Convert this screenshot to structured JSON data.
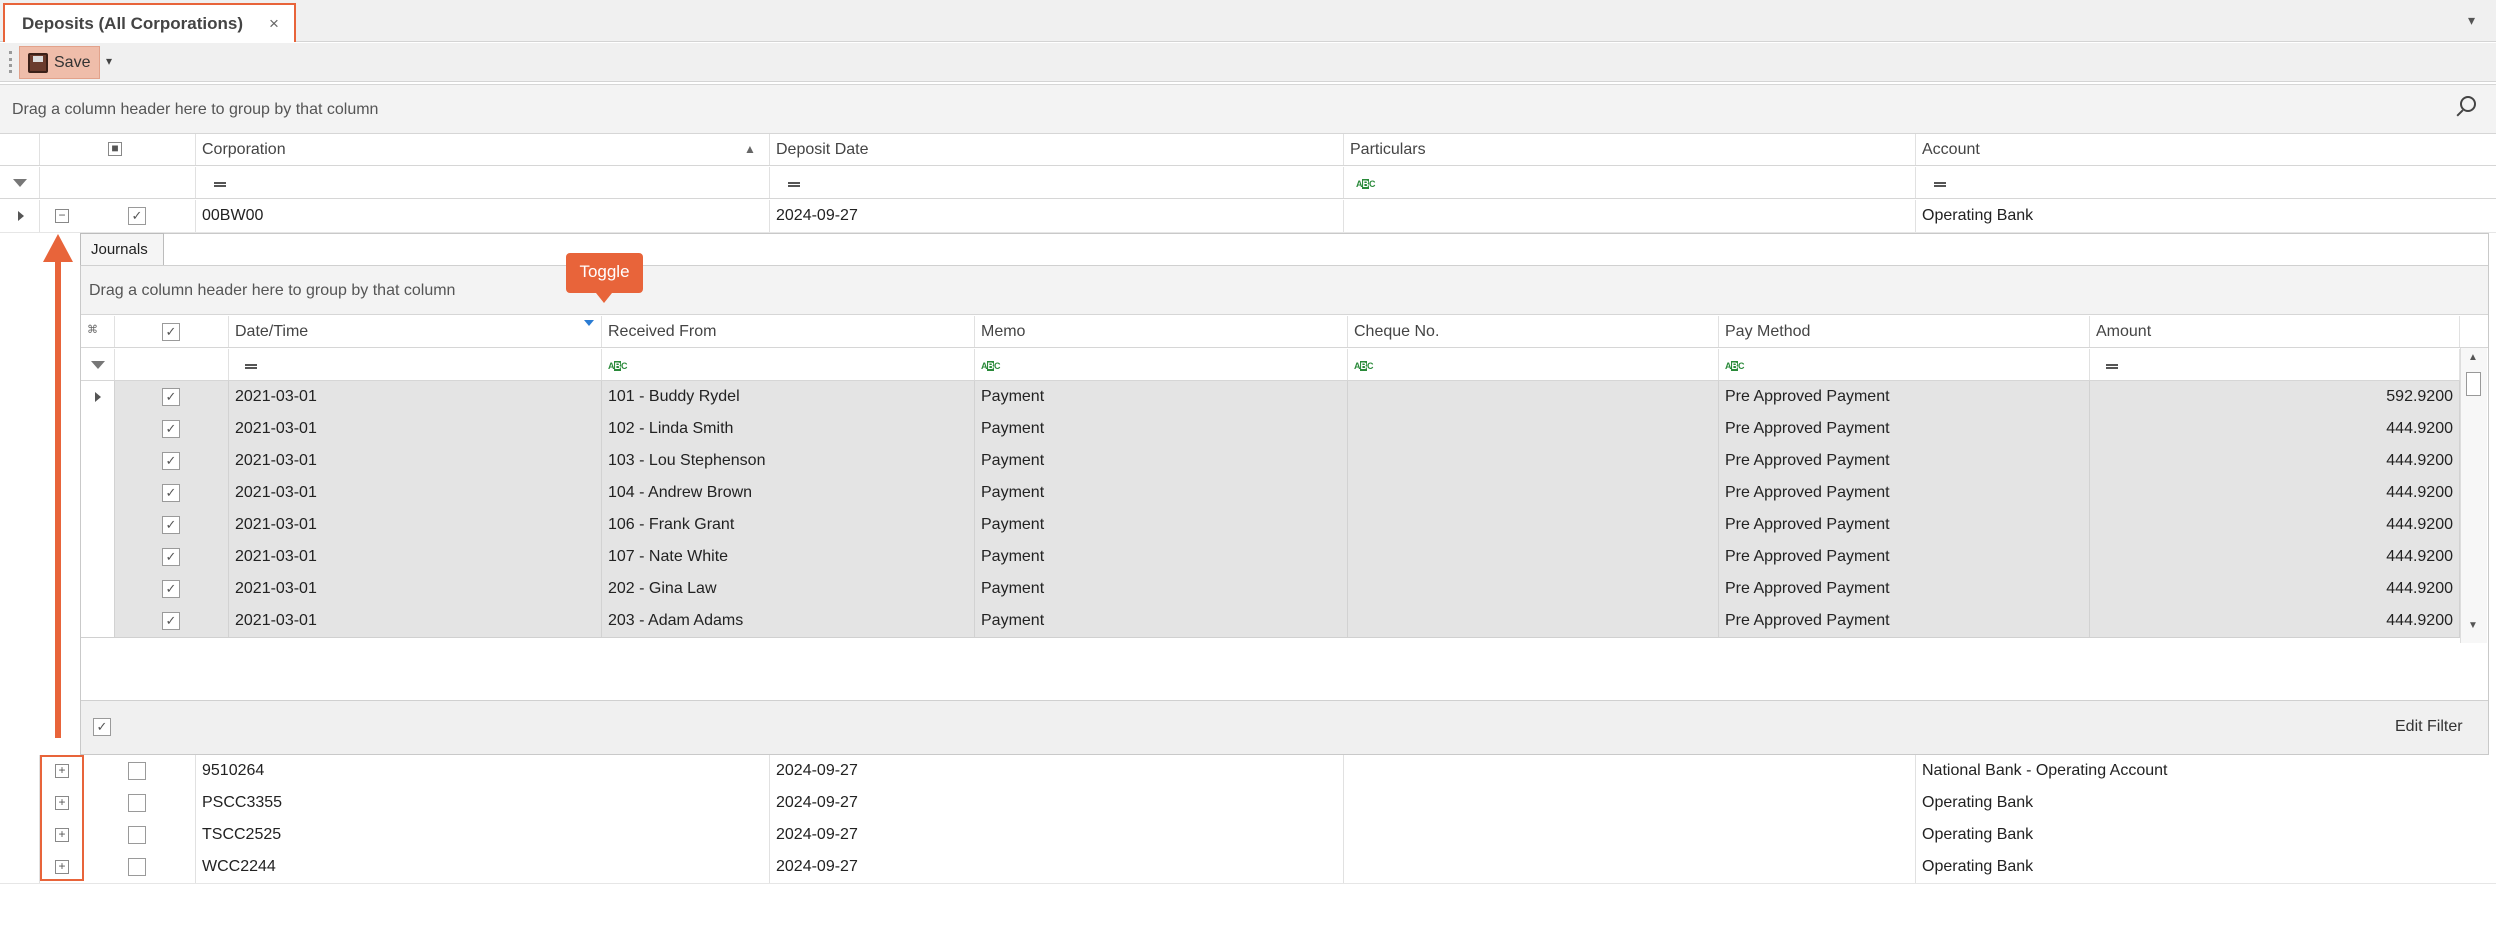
{
  "window": {
    "tab_title": "Deposits (All Corporations)",
    "tab_close": "×",
    "tab_menu": "▾"
  },
  "toolbar": {
    "save_label": "Save",
    "save_dropdown": "▾"
  },
  "main_grid": {
    "group_hint": "Drag a column header here to group by that column",
    "columns": [
      "Corporation",
      "Deposit Date",
      "Particulars",
      "Account"
    ],
    "expanded_row": {
      "corporation": "00BW00",
      "deposit_date": "2024-09-27",
      "particulars": "",
      "account": "Operating Bank"
    },
    "rows": [
      {
        "corporation": "9510264",
        "deposit_date": "2024-09-27",
        "particulars": "",
        "account": "National Bank - Operating Account"
      },
      {
        "corporation": "PSCC3355",
        "deposit_date": "2024-09-27",
        "particulars": "",
        "account": "Operating Bank"
      },
      {
        "corporation": "TSCC2525",
        "deposit_date": "2024-09-27",
        "particulars": "",
        "account": "Operating Bank"
      },
      {
        "corporation": "WCC2244",
        "deposit_date": "2024-09-27",
        "particulars": "",
        "account": "Operating Bank"
      }
    ]
  },
  "detail": {
    "tab_label": "Journals",
    "group_hint": "Drag a column header here to group by that column",
    "columns": [
      "Date/Time",
      "Received From",
      "Memo",
      "Cheque No.",
      "Pay Method",
      "Amount"
    ],
    "rows": [
      {
        "date": "2021-03-01",
        "from": "101 - Buddy Rydel",
        "memo": "Payment",
        "cheque": "",
        "method": "Pre Approved Payment",
        "amount": "592.9200"
      },
      {
        "date": "2021-03-01",
        "from": "102 - Linda Smith",
        "memo": "Payment",
        "cheque": "",
        "method": "Pre Approved Payment",
        "amount": "444.9200"
      },
      {
        "date": "2021-03-01",
        "from": "103 - Lou Stephenson",
        "memo": "Payment",
        "cheque": "",
        "method": "Pre Approved Payment",
        "amount": "444.9200"
      },
      {
        "date": "2021-03-01",
        "from": "104 - Andrew Brown",
        "memo": "Payment",
        "cheque": "",
        "method": "Pre Approved Payment",
        "amount": "444.9200"
      },
      {
        "date": "2021-03-01",
        "from": "106 - Frank Grant",
        "memo": "Payment",
        "cheque": "",
        "method": "Pre Approved Payment",
        "amount": "444.9200"
      },
      {
        "date": "2021-03-01",
        "from": "107 - Nate White",
        "memo": "Payment",
        "cheque": "",
        "method": "Pre Approved Payment",
        "amount": "444.9200"
      },
      {
        "date": "2021-03-01",
        "from": "202 - Gina Law",
        "memo": "Payment",
        "cheque": "",
        "method": "Pre Approved Payment",
        "amount": "444.9200"
      },
      {
        "date": "2021-03-01",
        "from": "203 - Adam Adams",
        "memo": "Payment",
        "cheque": "",
        "method": "Pre Approved Payment",
        "amount": "444.9200"
      }
    ],
    "footer_edit_filter": "Edit Filter"
  },
  "annotation": {
    "callout": "Toggle",
    "accent": "#e8643a"
  }
}
